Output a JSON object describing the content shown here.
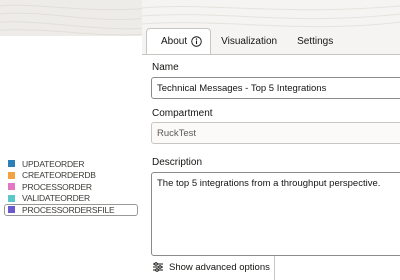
{
  "legend": {
    "items": [
      {
        "label": "UPDATEORDER",
        "color": "#2c7fb8"
      },
      {
        "label": "CREATEORDERDB",
        "color": "#f1a340"
      },
      {
        "label": "PROCESSORDER",
        "color": "#e377c2"
      },
      {
        "label": "VALIDATEORDER",
        "color": "#5ac8c8"
      },
      {
        "label": "PROCESSORDERSFILE",
        "color": "#6a5acd"
      }
    ]
  },
  "tabs": [
    {
      "label": "About",
      "icon": "info-icon",
      "active": true
    },
    {
      "label": "Visualization"
    },
    {
      "label": "Settings"
    }
  ],
  "form": {
    "name_label": "Name",
    "name_value": "Technical Messages - Top 5 Integrations",
    "compartment_label": "Compartment",
    "compartment_value": "RuckTest",
    "description_label": "Description",
    "description_value": "The top 5 integrations from a throughput perspective."
  },
  "advanced": {
    "label": "Show advanced options",
    "icon": "sliders-icon"
  }
}
